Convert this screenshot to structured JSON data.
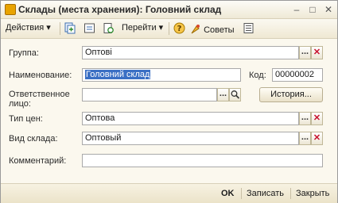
{
  "window": {
    "title": "Склады (места хранения): Головний склад",
    "minimize_glyph": "–",
    "maximize_glyph": "□",
    "close_glyph": "✕"
  },
  "toolbar": {
    "actions_label": "Действия",
    "goto_label": "Перейти",
    "tips_label": "Советы",
    "dropdown_glyph": "▾"
  },
  "form": {
    "group_label": "Группа:",
    "group_value": "Оптові",
    "name_label": "Наименование:",
    "name_value": "Головний склад",
    "code_label": "Код:",
    "code_value": "00000002",
    "responsible_label_1": "Ответственное",
    "responsible_label_2": "лицо:",
    "responsible_value": "",
    "history_button": "История...",
    "price_type_label": "Тип цен:",
    "price_type_value": "Оптова",
    "warehouse_type_label": "Вид склада:",
    "warehouse_type_value": "Оптовый",
    "comment_label": "Комментарий:",
    "comment_value": "",
    "select_glyph": "...",
    "clear_glyph": "✕"
  },
  "bottom": {
    "ok_label": "OK",
    "save_label": "Записать",
    "close_label": "Закрыть"
  }
}
